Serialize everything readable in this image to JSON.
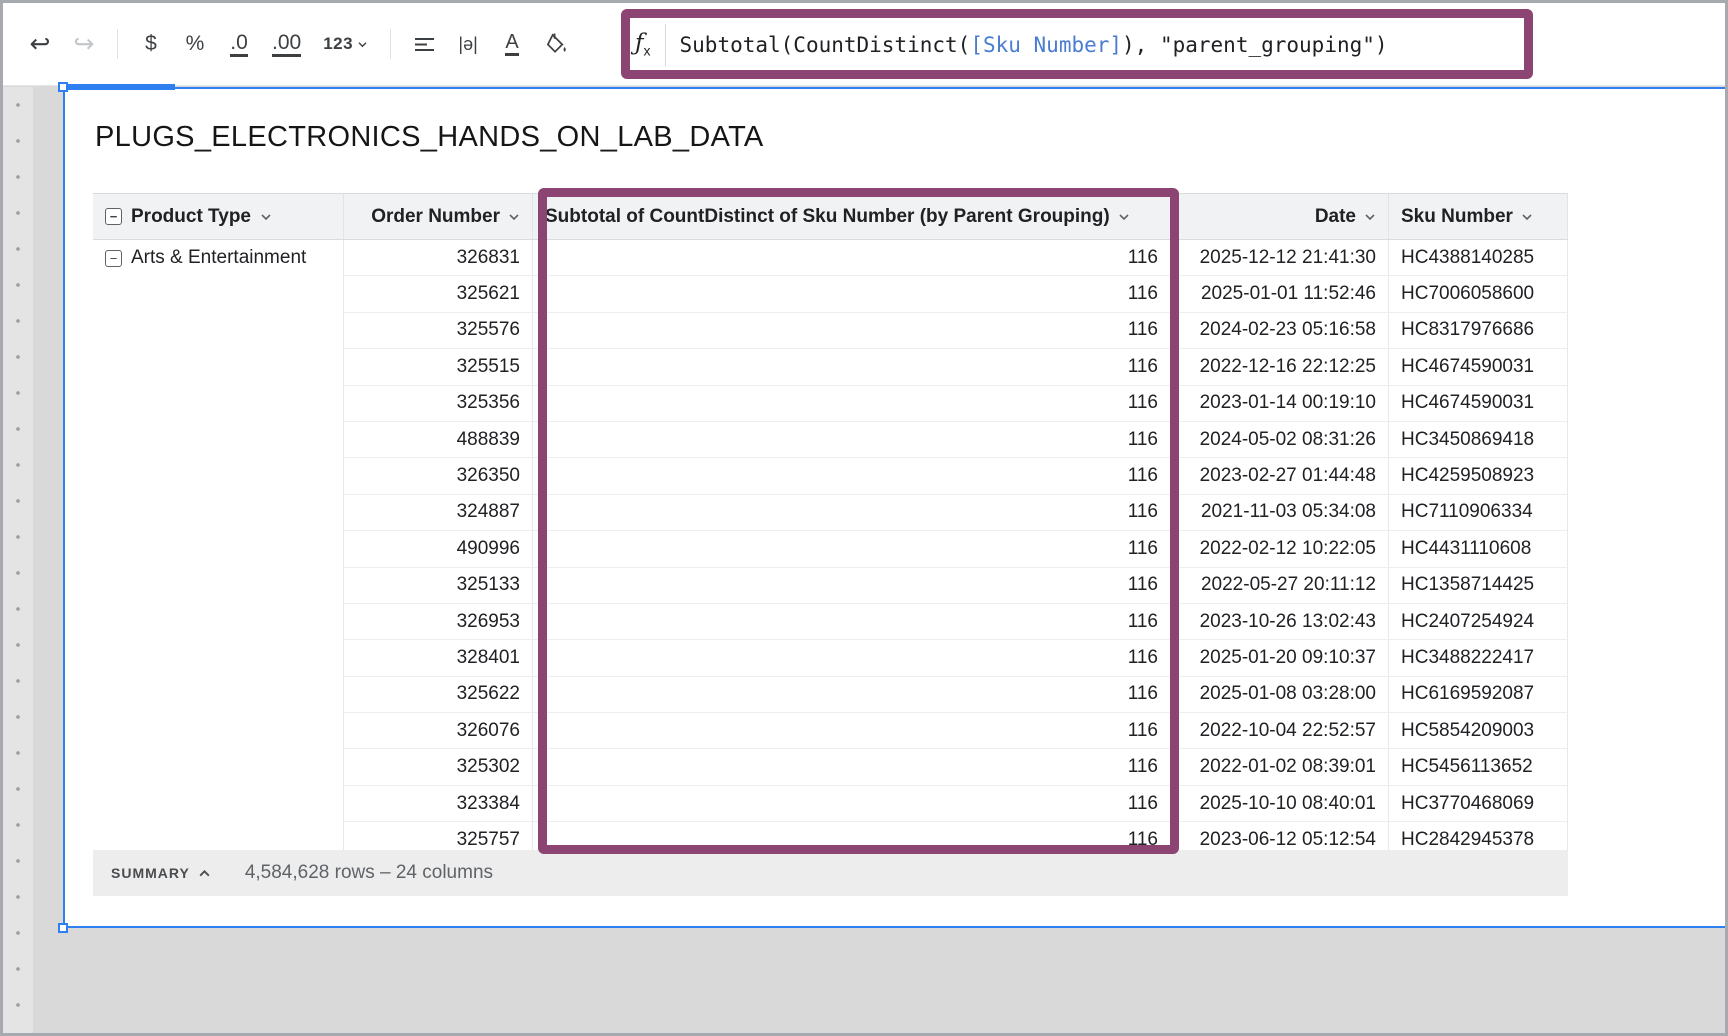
{
  "toolbar": {
    "undo": "↩",
    "redo": "↪",
    "currency": "$",
    "percent": "%",
    "decrease_decimal": ".0",
    "increase_decimal": ".00",
    "number_format": "123",
    "text_overflow": "|ə|",
    "text_color": "A",
    "fx_f": "ƒ",
    "fx_x": "x",
    "formula": {
      "pre": "Subtotal(CountDistinct(",
      "ref": "[Sku Number]",
      "post": "), \"parent_grouping\")"
    }
  },
  "icons": {
    "collapse_minus": "−"
  },
  "sheet": {
    "title": "PLUGS_ELECTRONICS_HANDS_ON_LAB_DATA",
    "summary_label": "SUMMARY",
    "summary_stats": "4,584,628 rows – 24 columns"
  },
  "table": {
    "headers": {
      "product": "Product Type",
      "order": "Order Number",
      "subtotal": "Subtotal of CountDistinct of Sku Number (by Parent Grouping)",
      "date": "Date",
      "sku": "Sku Number"
    },
    "rows": [
      {
        "product": "Arts & Entertainment",
        "order": "326831",
        "subtotal": "116",
        "date": "2025-12-12 21:41:30",
        "sku": "HC4388140285"
      },
      {
        "product": "",
        "order": "325621",
        "subtotal": "116",
        "date": "2025-01-01 11:52:46",
        "sku": "HC7006058600"
      },
      {
        "product": "",
        "order": "325576",
        "subtotal": "116",
        "date": "2024-02-23 05:16:58",
        "sku": "HC8317976686"
      },
      {
        "product": "",
        "order": "325515",
        "subtotal": "116",
        "date": "2022-12-16 22:12:25",
        "sku": "HC4674590031"
      },
      {
        "product": "",
        "order": "325356",
        "subtotal": "116",
        "date": "2023-01-14 00:19:10",
        "sku": "HC4674590031"
      },
      {
        "product": "",
        "order": "488839",
        "subtotal": "116",
        "date": "2024-05-02 08:31:26",
        "sku": "HC3450869418"
      },
      {
        "product": "",
        "order": "326350",
        "subtotal": "116",
        "date": "2023-02-27 01:44:48",
        "sku": "HC4259508923"
      },
      {
        "product": "",
        "order": "324887",
        "subtotal": "116",
        "date": "2021-11-03 05:34:08",
        "sku": "HC7110906334"
      },
      {
        "product": "",
        "order": "490996",
        "subtotal": "116",
        "date": "2022-02-12 10:22:05",
        "sku": "HC4431110608"
      },
      {
        "product": "",
        "order": "325133",
        "subtotal": "116",
        "date": "2022-05-27 20:11:12",
        "sku": "HC1358714425"
      },
      {
        "product": "",
        "order": "326953",
        "subtotal": "116",
        "date": "2023-10-26 13:02:43",
        "sku": "HC2407254924"
      },
      {
        "product": "",
        "order": "328401",
        "subtotal": "116",
        "date": "2025-01-20 09:10:37",
        "sku": "HC3488222417"
      },
      {
        "product": "",
        "order": "325622",
        "subtotal": "116",
        "date": "2025-01-08 03:28:00",
        "sku": "HC6169592087"
      },
      {
        "product": "",
        "order": "326076",
        "subtotal": "116",
        "date": "2022-10-04 22:52:57",
        "sku": "HC5854209003"
      },
      {
        "product": "",
        "order": "325302",
        "subtotal": "116",
        "date": "2022-01-02 08:39:01",
        "sku": "HC5456113652"
      },
      {
        "product": "",
        "order": "323384",
        "subtotal": "116",
        "date": "2025-10-10 08:40:01",
        "sku": "HC3770468069"
      },
      {
        "product": "",
        "order": "325757",
        "subtotal": "116",
        "date": "2023-06-12 05:12:54",
        "sku": "HC2842945378"
      }
    ]
  },
  "colors": {
    "highlight": "#8c4472",
    "selection_blue": "#2e7ff0",
    "formula_ref_blue": "#4a7dd0"
  }
}
